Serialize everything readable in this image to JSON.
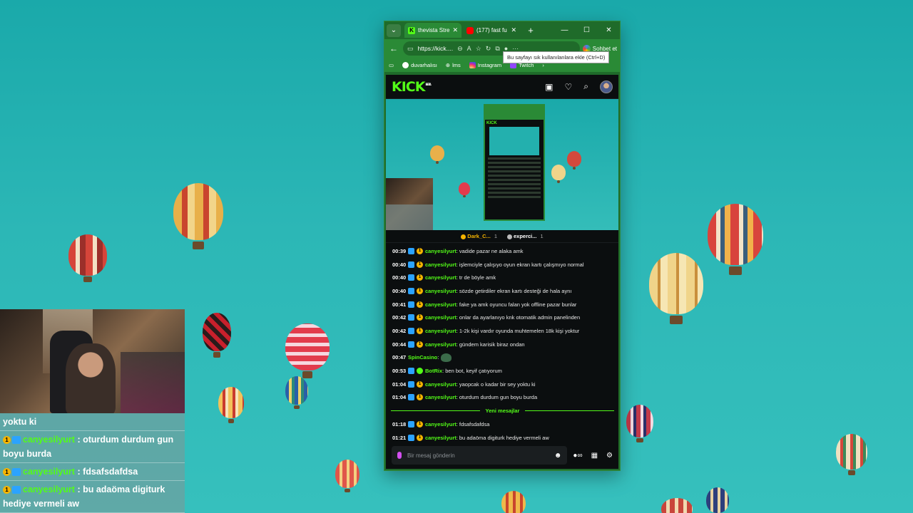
{
  "browser": {
    "tabs": [
      {
        "title": "thevista Stre",
        "active": true
      },
      {
        "title": "(177) fast fu",
        "active": false
      }
    ],
    "url": "https://kick....",
    "copilot_label": "Sohbet et",
    "tooltip": "Bu sayfayı sık kullanılanlara ekle (Ctrl+D)",
    "bookmarks": [
      "duvarhalısı",
      "lms",
      "Instagram",
      "Twitch"
    ]
  },
  "kick": {
    "logo": "KICK",
    "logo_badge": "BETA",
    "viewers": [
      {
        "name": "Dark_C...",
        "count": "1"
      },
      {
        "name": "experci...",
        "count": "1"
      }
    ],
    "messages": [
      {
        "time": "00:39",
        "user": "canyesilyurt",
        "text": "vadide pazar ne alaka amk"
      },
      {
        "time": "00:40",
        "user": "canyesilyurt",
        "text": "işlemciyle çalışıyo oyun ekran kartı çalışmıyo normal"
      },
      {
        "time": "00:40",
        "user": "canyesilyurt",
        "text": "tr de böyle amk"
      },
      {
        "time": "00:40",
        "user": "canyesilyurt",
        "text": "sözde getirdiler ekran kartı desteği de hala aynı"
      },
      {
        "time": "00:41",
        "user": "canyesilyurt",
        "text": "fake ya amk oyuncu falan yok offline pazar bunlar"
      },
      {
        "time": "00:42",
        "user": "canyesilyurt",
        "text": "onlar da ayarlanıyo knk otomatik admin panelinden"
      },
      {
        "time": "00:42",
        "user": "canyesilyurt",
        "text": "1-2k kişi vardır oyunda muhtemelen 18k kişi yoktur"
      },
      {
        "time": "00:44",
        "user": "canyesilyurt",
        "text": "gündem karisik biraz ondan"
      },
      {
        "time": "00:47",
        "user": "SpinCasino",
        "text": ""
      },
      {
        "time": "00:53",
        "user": "BotRix",
        "text": "ben bot, keyif çatıyorum"
      },
      {
        "time": "01:04",
        "user": "canyesilyurt",
        "text": "yaopcak o kadar bir sey yoktu ki"
      },
      {
        "time": "01:04",
        "user": "canyesilyurt",
        "text": "oturdum durdum gun boyu burda"
      }
    ],
    "new_messages_label": "Yeni mesajlar",
    "new_messages": [
      {
        "time": "01:18",
        "user": "canyesilyurt",
        "text": "fdsafsdafdsa"
      },
      {
        "time": "01:21",
        "user": "canyesilyurt",
        "text": "bu adaöma digiturk hediye vermeli aw"
      }
    ],
    "input_placeholder": "Bir mesaj gönderin"
  },
  "overlay": {
    "messages": [
      {
        "user": "",
        "text": "yoktu ki"
      },
      {
        "user": "canyesilyurt",
        "text": "oturdum durdum gun boyu burda"
      },
      {
        "user": "canyesilyurt",
        "text": "fdsafsdafdsa"
      },
      {
        "user": "canyesilyurt",
        "text": "bu adaöma digiturk hediye vermeli aw"
      }
    ]
  },
  "colors": {
    "kick_green": "#53fc18",
    "edge_green": "#2a8a36",
    "sky": "#1aa9aa"
  }
}
